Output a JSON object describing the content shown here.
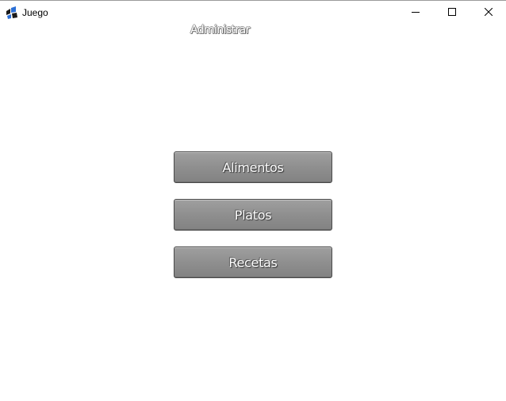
{
  "window": {
    "title": "Juego",
    "icon": "app-logo-icon",
    "controls": [
      "minimize-icon",
      "maximize-icon",
      "close-icon"
    ]
  },
  "header": {
    "label": "Administrar"
  },
  "menu": {
    "buttons": [
      {
        "label": "Alimentos"
      },
      {
        "label": "Platos"
      },
      {
        "label": "Recetas"
      }
    ]
  },
  "colors": {
    "button_fill": "#8f8f8f",
    "button_border": "#4a4a4a",
    "button_text": "#ffffff",
    "background": "#ffffff"
  }
}
